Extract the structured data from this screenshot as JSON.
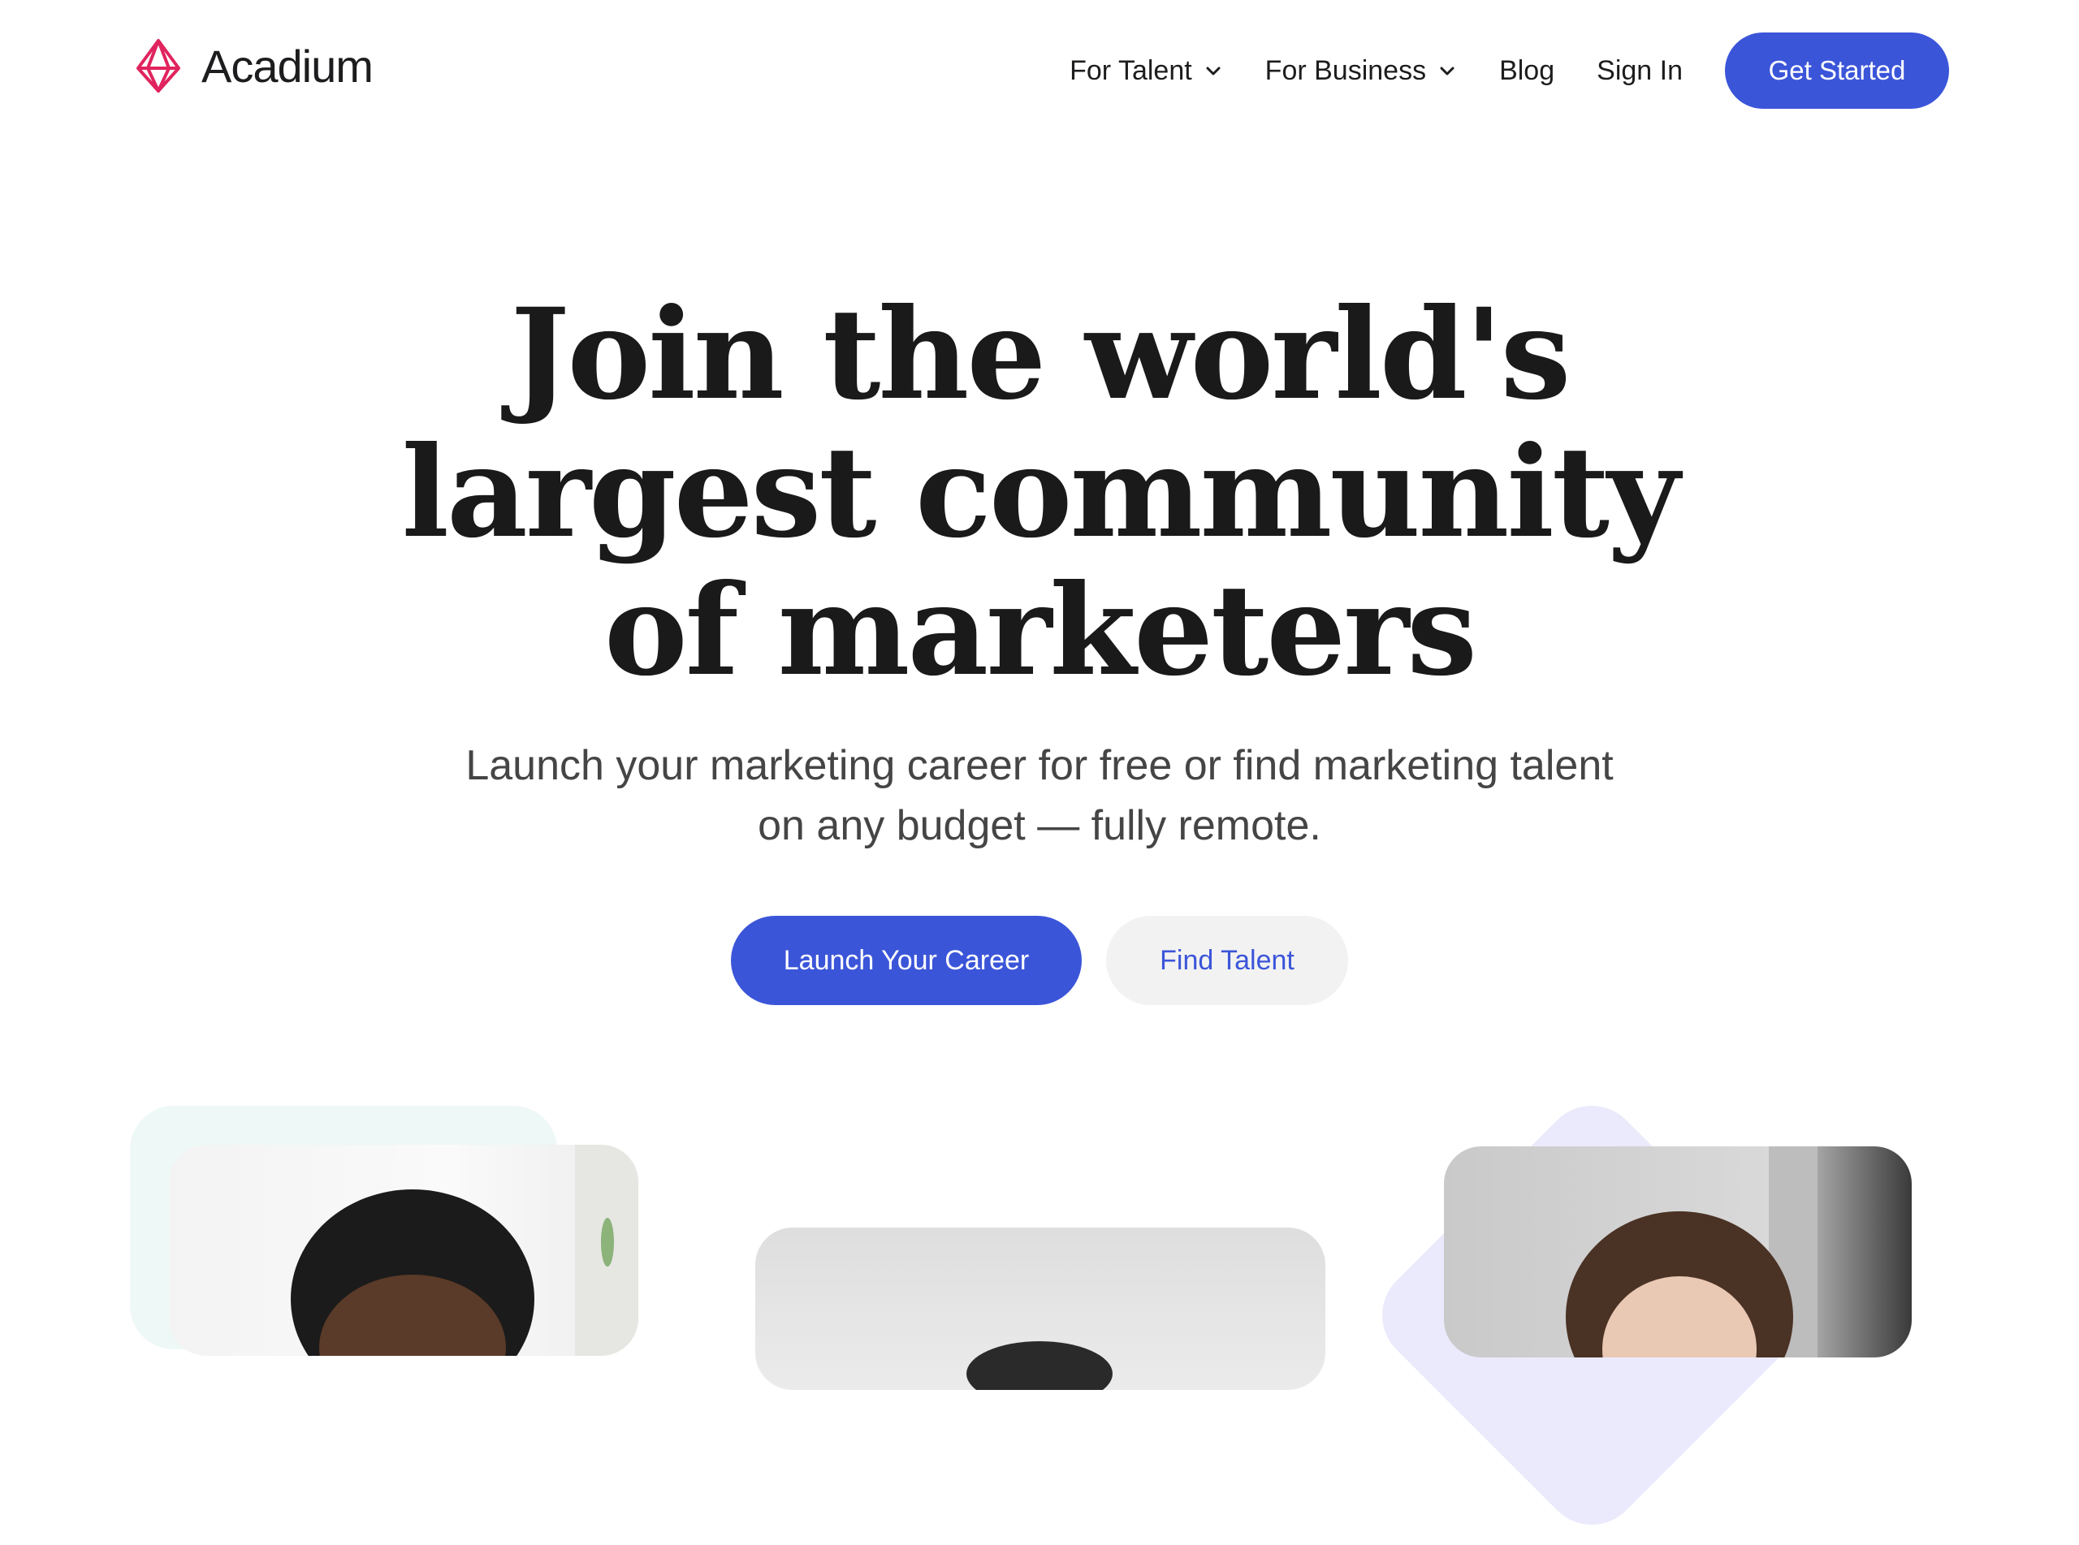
{
  "brand": {
    "name": "Acadium",
    "logo_color": "#e0245e"
  },
  "nav": {
    "items": [
      {
        "label": "For Talent",
        "icon": "chevron-down-icon"
      },
      {
        "label": "For Business",
        "icon": "chevron-down-icon"
      },
      {
        "label": "Blog"
      },
      {
        "label": "Sign In"
      }
    ],
    "cta_label": "Get Started"
  },
  "hero": {
    "title_lines": [
      "Join the world's",
      "largest community",
      "of marketers"
    ],
    "subtitle_lines": [
      "Launch your marketing career for free or find marketing talent",
      "on any budget — fully remote."
    ],
    "primary_cta": "Launch Your Career",
    "secondary_cta": "Find Talent"
  },
  "colors": {
    "accent": "#3b55d9",
    "text": "#1a1a1a",
    "subtext": "#454545",
    "secondary_button_bg": "#f2f2f2",
    "mint": "#eef8f6",
    "lavender": "#ebeafc"
  }
}
